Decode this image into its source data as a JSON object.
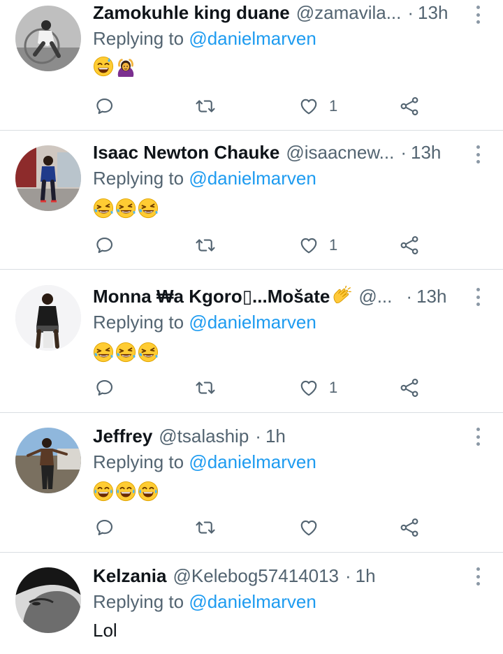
{
  "replying_to_label": "Replying to",
  "tweets": [
    {
      "name": "Zamokuhle king duane",
      "handle": "@zamavila...",
      "dot": "·",
      "time": "13h",
      "mention": "@danielmarven",
      "text": "",
      "emojis": [
        "grinning-sweat-emoji",
        "person-gesturing-ok-emoji"
      ],
      "likes": "1",
      "avatar": "bw-photo-man-sitting"
    },
    {
      "name": "Isaac Newton Chauke",
      "handle": "@isaacnew...",
      "dot": "·",
      "time": "13h",
      "mention": "@danielmarven",
      "text": "",
      "emojis": [
        "rolling-on-floor-laughing-emoji",
        "rolling-on-floor-laughing-emoji",
        "rolling-on-floor-laughing-emoji"
      ],
      "likes": "1",
      "avatar": "man-standing-outdoors"
    },
    {
      "name": "Monna ₩a Kgoro▯...Mošate",
      "handle": "@...",
      "dot": "·",
      "time": "13h",
      "mention": "@danielmarven",
      "text": "",
      "emojis": [
        "rolling-on-floor-laughing-emoji",
        "rolling-on-floor-laughing-emoji",
        "rolling-on-floor-laughing-emoji"
      ],
      "likes": "1",
      "avatar": "man-seated-white-background"
    },
    {
      "name": "Jeffrey",
      "handle": "@tsalaship",
      "dot": "·",
      "time": "1h",
      "mention": "@danielmarven",
      "text": "",
      "emojis": [
        "face-with-tears-of-joy-emoji",
        "face-with-tears-of-joy-emoji",
        "face-with-tears-of-joy-emoji"
      ],
      "likes": "",
      "avatar": "shirtless-man-outdoors"
    },
    {
      "name": "Kelzania",
      "handle": "@Kelebog57414013",
      "dot": "·",
      "time": "1h",
      "mention": "@danielmarven",
      "text": "Lol",
      "emojis": [],
      "likes": "",
      "avatar": "woman-face-closeup"
    }
  ],
  "icons": {
    "reply": "speech-bubble-icon",
    "retweet": "retweet-arrows-icon",
    "like": "heart-outline-icon",
    "share": "share-nodes-icon",
    "more": "vertical-dots-icon"
  },
  "colors": {
    "name": "#0f1419",
    "secondary": "#536471",
    "mention": "#1d9bf0",
    "divider": "#d9dee2"
  }
}
